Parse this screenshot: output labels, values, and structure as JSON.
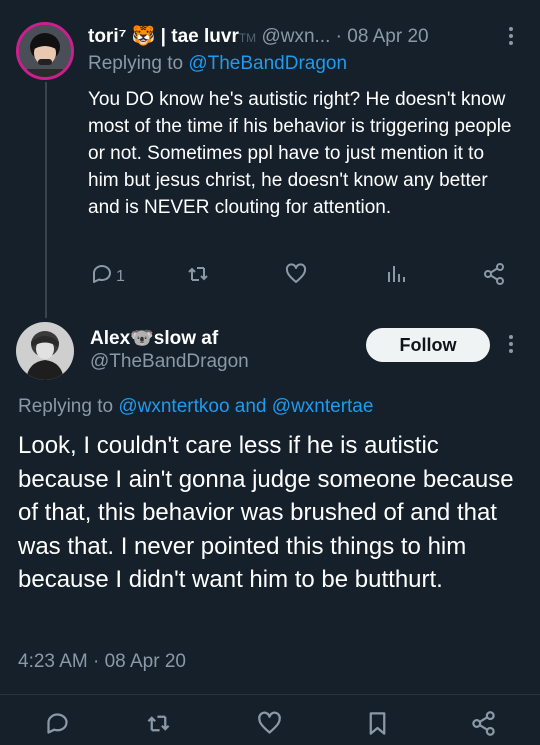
{
  "reply_tweet": {
    "display_name": "tori⁷ 🐯 | tae luvr",
    "name_suffix": "TM",
    "handle": "@wxn...",
    "date_sep": "·",
    "date": "08 Apr 20",
    "replying_prefix": "Replying to",
    "replying_to": "@TheBandDragon",
    "text": "You DO know he's autistic right? He doesn't know most of the time if his behavior is triggering people or not. Sometimes ppl have to just mention it to him but jesus christ, he doesn't know any better and is NEVER clouting for attention.",
    "reply_count": "1",
    "icons": [
      "reply-icon",
      "retweet-icon",
      "like-icon",
      "views-icon",
      "share-icon",
      "more-icon"
    ]
  },
  "main_tweet": {
    "display_name": "Alex🐨slow af",
    "handle": "@TheBandDragon",
    "follow_label": "Follow",
    "replying_prefix": "Replying to",
    "replying_to_1": "@wxntertkoo",
    "replying_and": "and",
    "replying_to_2": "@wxntertae",
    "text": "Look, I couldn't care less if he is autistic because I ain't gonna judge someone because of that, this behavior was brushed of and that was that. I never pointed this things to him because I didn't want him to be butthurt.",
    "time": "4:23 AM",
    "date_sep": "·",
    "date": "08 Apr 20",
    "icons": [
      "reply-icon",
      "retweet-icon",
      "like-icon",
      "bookmark-icon",
      "share-icon",
      "more-icon"
    ]
  },
  "colors": {
    "background": "#15202b",
    "link": "#1d9bf0",
    "muted": "#8b98a5",
    "avatar_ring": "#cc1f8f"
  }
}
